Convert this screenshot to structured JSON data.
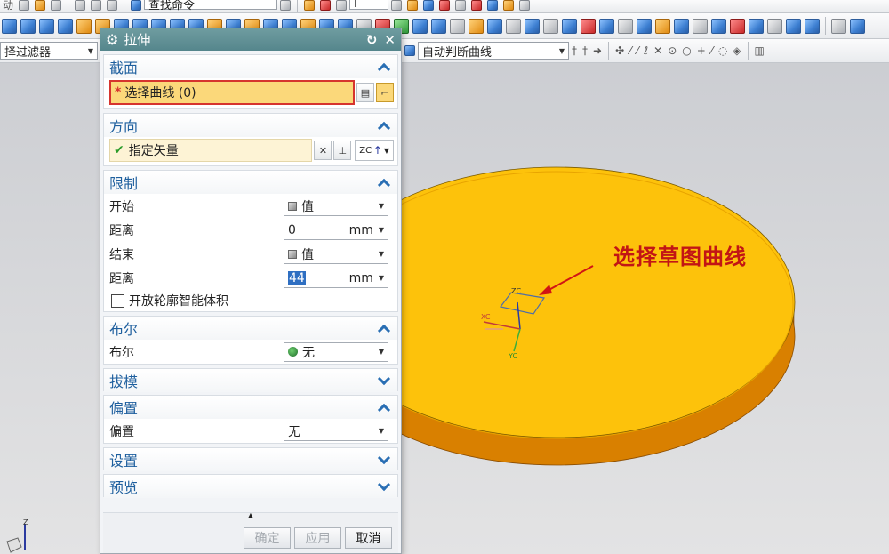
{
  "toolbar": {
    "row1_partial_label": "动",
    "command_finder": "查找命令",
    "row1_combo_value": "I",
    "selection_filter": "择过滤器",
    "curve_rule": "自动判断曲线"
  },
  "viewport": {
    "callout": "选择草图曲线",
    "axis_labels": {
      "xc": "XC",
      "yc": "YC",
      "zc": "ZC",
      "z": "Z"
    },
    "colors": {
      "disk_top": "#fdc20b",
      "disk_side": "#d98000",
      "callout": "#c21515"
    }
  },
  "dialog": {
    "title": "拉伸",
    "title_icons": [
      "gear-icon",
      "reset-icon",
      "close-icon"
    ],
    "section": {
      "title": "截面",
      "select_curve": {
        "required_mark": "*",
        "label": "选择曲线 (0)"
      }
    },
    "direction": {
      "title": "方向",
      "vector_label": "指定矢量",
      "vector_button": "ZC"
    },
    "limits": {
      "title": "限制",
      "start_label": "开始",
      "start_option": "值",
      "start_distance_label": "距离",
      "start_distance": "0",
      "start_unit": "mm",
      "end_label": "结束",
      "end_option": "值",
      "end_distance_label": "距离",
      "end_distance": "44",
      "end_unit": "mm",
      "open_profile": "开放轮廓智能体积"
    },
    "boolean": {
      "title": "布尔",
      "label": "布尔",
      "value": "无"
    },
    "draft": {
      "title": "拔模"
    },
    "offset": {
      "title": "偏置",
      "label": "偏置",
      "value": "无"
    },
    "settings": {
      "title": "设置"
    },
    "preview": {
      "title": "预览"
    },
    "buttons": {
      "ok": "确定",
      "apply": "应用",
      "cancel": "取消"
    }
  }
}
